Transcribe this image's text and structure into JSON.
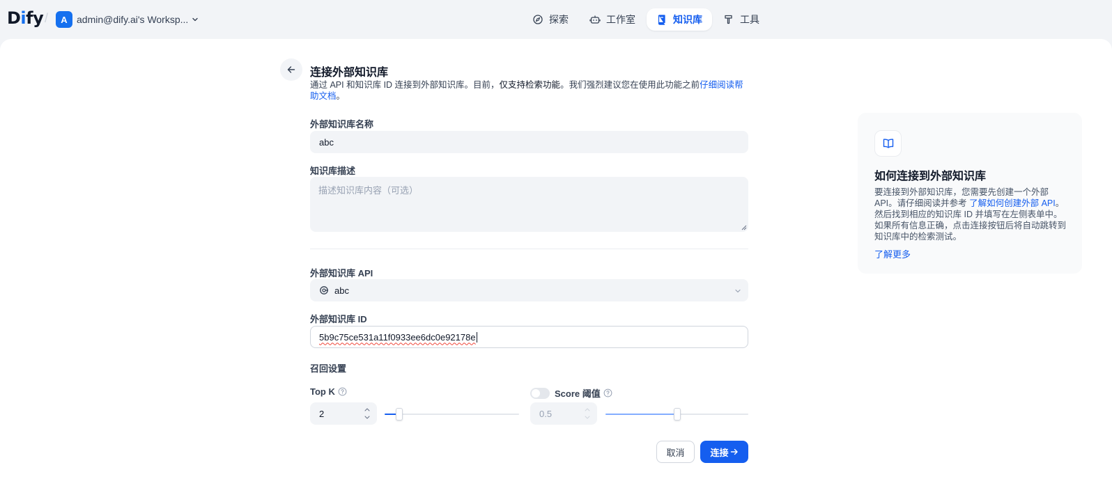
{
  "header": {
    "logo_prefix": "D",
    "logo_i": "i",
    "logo_suffix": "fy",
    "workspace_initial": "A",
    "workspace_name": "admin@dify.ai's Worksp...",
    "nav": [
      {
        "label": "探索",
        "icon": "compass-icon"
      },
      {
        "label": "工作室",
        "icon": "robot-icon"
      },
      {
        "label": "知识库",
        "icon": "book-icon",
        "active": true
      },
      {
        "label": "工具",
        "icon": "hammer-icon"
      }
    ]
  },
  "form": {
    "title": "连接外部知识库",
    "desc_part1": "通过 API 和知识库 ID 连接到外部知识库。目前，",
    "desc_emphasis": "仅支持检索功能",
    "desc_part2": "。我们强烈建议您在使用此功能之前",
    "desc_link": "仔细阅读帮助文档",
    "desc_end": "。",
    "name_label": "外部知识库名称",
    "name_value": "abc",
    "desc_label": "知识库描述",
    "desc_placeholder": "描述知识库内容（可选）",
    "api_label": "外部知识库 API",
    "api_value": "abc",
    "id_label": "外部知识库 ID",
    "id_value": "5b9c75ce531a11f0933ee6dc0e92178e",
    "retrieval_label": "召回设置",
    "topk_label": "Top K",
    "topk_value": "2",
    "topk_slider": 2,
    "score_label": "Score 阈值",
    "score_value": "0.5",
    "score_enabled": false,
    "cancel_label": "取消",
    "connect_label": "连接"
  },
  "help": {
    "title": "如何连接到外部知识库",
    "body_part1": "要连接到外部知识库，您需要先创建一个外部 API。请仔细阅读并参考 ",
    "body_link": "了解如何创建外部 API",
    "body_part2": "。然后找到相应的知识库 ID 并填写在左侧表单中。如果所有信息正确，点击连接按钮后将自动跳转到知识库中的检索测试。",
    "more_label": "了解更多"
  },
  "colors": {
    "accent": "#155eef",
    "page_bg": "#f2f4f7",
    "input_bg": "#f2f4f7"
  }
}
